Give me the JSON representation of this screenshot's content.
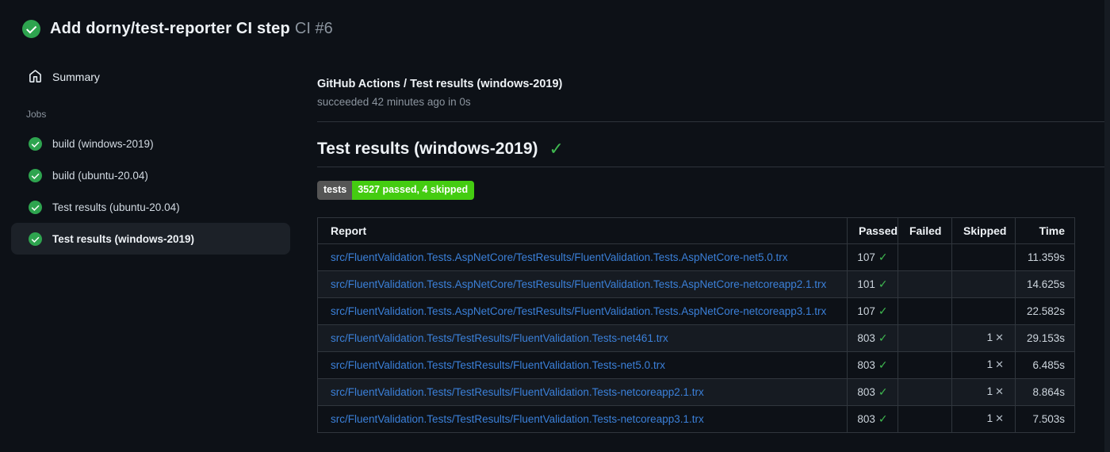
{
  "header": {
    "title": "Add dorny/test-reporter CI step",
    "run_number": "CI #6"
  },
  "sidebar": {
    "summary_label": "Summary",
    "jobs_label": "Jobs",
    "jobs": [
      {
        "label": "build (windows-2019)",
        "selected": false
      },
      {
        "label": "build (ubuntu-20.04)",
        "selected": false
      },
      {
        "label": "Test results (ubuntu-20.04)",
        "selected": false
      },
      {
        "label": "Test results (windows-2019)",
        "selected": true
      }
    ]
  },
  "main": {
    "check_title": "GitHub Actions / Test results (windows-2019)",
    "check_status": "succeeded 42 minutes ago in 0s",
    "section_title": "Test results (windows-2019)",
    "section_check": "✓",
    "badge": {
      "label": "tests",
      "value": "3527 passed, 4 skipped",
      "label_bg": "#555555",
      "value_bg": "#44cc11"
    },
    "table": {
      "headers": [
        "Report",
        "Passed",
        "Failed",
        "Skipped",
        "Time"
      ],
      "pass_icon": "✓",
      "skip_icon": "✕",
      "rows": [
        {
          "report": "src/FluentValidation.Tests.AspNetCore/TestResults/FluentValidation.Tests.AspNetCore-net5.0.trx",
          "passed": "107",
          "failed": "",
          "skipped": "",
          "time": "11.359s"
        },
        {
          "report": "src/FluentValidation.Tests.AspNetCore/TestResults/FluentValidation.Tests.AspNetCore-netcoreapp2.1.trx",
          "passed": "101",
          "failed": "",
          "skipped": "",
          "time": "14.625s"
        },
        {
          "report": "src/FluentValidation.Tests.AspNetCore/TestResults/FluentValidation.Tests.AspNetCore-netcoreapp3.1.trx",
          "passed": "107",
          "failed": "",
          "skipped": "",
          "time": "22.582s"
        },
        {
          "report": "src/FluentValidation.Tests/TestResults/FluentValidation.Tests-net461.trx",
          "passed": "803",
          "failed": "",
          "skipped": "1",
          "time": "29.153s"
        },
        {
          "report": "src/FluentValidation.Tests/TestResults/FluentValidation.Tests-net5.0.trx",
          "passed": "803",
          "failed": "",
          "skipped": "1",
          "time": "6.485s"
        },
        {
          "report": "src/FluentValidation.Tests/TestResults/FluentValidation.Tests-netcoreapp2.1.trx",
          "passed": "803",
          "failed": "",
          "skipped": "1",
          "time": "8.864s"
        },
        {
          "report": "src/FluentValidation.Tests/TestResults/FluentValidation.Tests-netcoreapp3.1.trx",
          "passed": "803",
          "failed": "",
          "skipped": "1",
          "time": "7.503s"
        }
      ]
    }
  },
  "colors": {
    "success_green": "#2ea44f",
    "check_green": "#3fb950",
    "link_blue": "#3b80d9",
    "background": "#0d1117"
  }
}
